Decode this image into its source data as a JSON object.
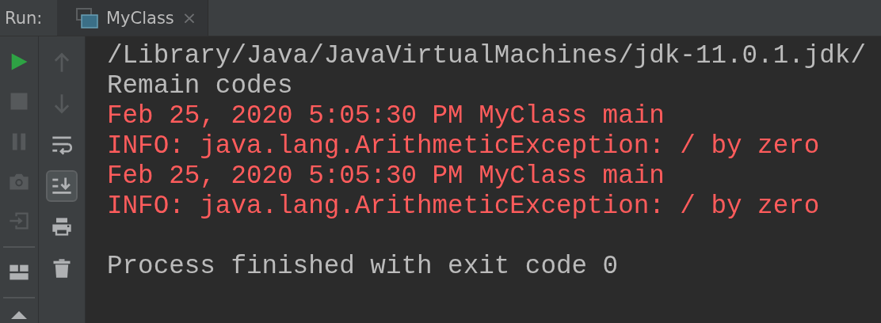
{
  "run_label": "Run:",
  "tabs": [
    {
      "label": "MyClass",
      "selected": true,
      "close": "×"
    }
  ],
  "left_toolbar": [
    {
      "kind": "run",
      "disabled": false
    },
    {
      "kind": "stop",
      "disabled": true
    },
    {
      "kind": "pause",
      "disabled": true
    },
    {
      "kind": "camera",
      "disabled": true
    },
    {
      "kind": "exit",
      "disabled": true
    },
    {
      "kind": "layout",
      "disabled": false
    },
    {
      "kind": "more",
      "disabled": false
    }
  ],
  "right_toolbar": [
    {
      "kind": "up",
      "disabled": true,
      "selected": false
    },
    {
      "kind": "down",
      "disabled": true,
      "selected": false
    },
    {
      "kind": "wrap",
      "disabled": false,
      "selected": false
    },
    {
      "kind": "scroll-end",
      "disabled": false,
      "selected": true
    },
    {
      "kind": "print",
      "disabled": false,
      "selected": false
    },
    {
      "kind": "trash",
      "disabled": false,
      "selected": false
    }
  ],
  "console_blocks": [
    {
      "lines": [
        {
          "text": "/Library/Java/JavaVirtualMachines/jdk-11.0.1.jdk/",
          "kind": "normal"
        },
        {
          "text": "Remain codes",
          "kind": "normal"
        },
        {
          "text": "Feb 25, 2020 5:05:30 PM MyClass main",
          "kind": "error"
        },
        {
          "text": "INFO: java.lang.ArithmeticException: / by zero",
          "kind": "error"
        },
        {
          "text": "Feb 25, 2020 5:05:30 PM MyClass main",
          "kind": "error"
        },
        {
          "text": "INFO: java.lang.ArithmeticException: / by zero",
          "kind": "error"
        }
      ]
    },
    {
      "lines": [
        {
          "text": "Process finished with exit code 0",
          "kind": "normal"
        }
      ]
    }
  ]
}
